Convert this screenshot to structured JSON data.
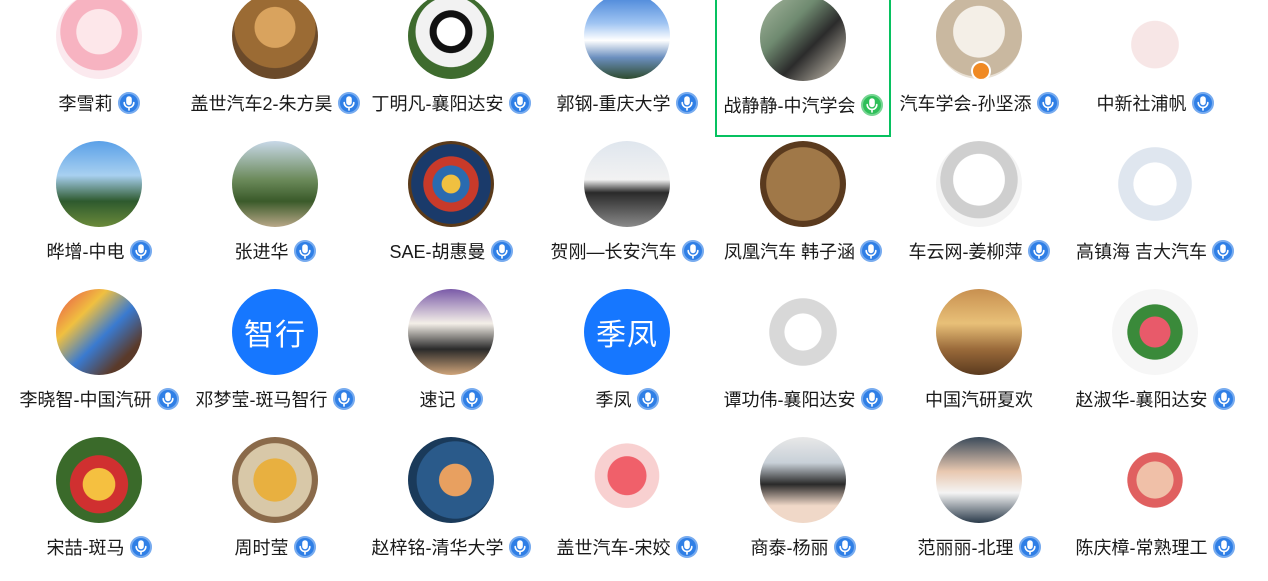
{
  "members": [
    {
      "name": "李雪莉",
      "mic": "blue",
      "avatar": {
        "kind": "image",
        "bg": "radial-gradient(circle at 50% 45%, #fde7ea 0 35%, #f7b3c1 36% 60%, #fbe9ee 61%)"
      }
    },
    {
      "name": "盖世汽车2-朱方昊",
      "mic": "blue",
      "avatar": {
        "kind": "image",
        "bg": "radial-gradient(circle at 50% 40%, #d9a35e 0 30%, #9b6b34 31% 60%, #6b4a2a 61%)"
      }
    },
    {
      "name": "丁明凡-襄阳达安",
      "mic": "blue",
      "avatar": {
        "kind": "image",
        "bg": "radial-gradient(circle at 50% 45%, #ffffff 0 22%, #111111 23% 33%, #f2f2f2 34% 55%, #3e6b2e 56%)"
      }
    },
    {
      "name": "郭钢-重庆大学",
      "mic": "blue",
      "avatar": {
        "kind": "image",
        "bg": "linear-gradient(180deg, #3f7fd6 0%, #9fc4f2 35%, #ffffff 55%, #6b8fbf 75%, #2e4b2e 100%)"
      }
    },
    {
      "name": "战静静-中汽学会",
      "mic": "green",
      "active": true,
      "avatar": {
        "kind": "image",
        "bg": "linear-gradient(135deg, #a8b8a0 0%, #6f8a70 35%, #2b2b2b 60%, #d8d0c0 100%)"
      }
    },
    {
      "name": "汽车学会-孙坚添",
      "mic": "blue",
      "badge": true,
      "avatar": {
        "kind": "image",
        "bg": "radial-gradient(circle at 50% 45%, #f4efe7 0 40%, #c9b8a0 41% 70%, #e8e0d4 71%)"
      }
    },
    {
      "name": "中新社浦帆",
      "mic": "blue",
      "avatar": {
        "kind": "image",
        "bg": "radial-gradient(circle at 50% 60%, #f7e6e6 0 35%, #ffffff 36%)"
      }
    },
    {
      "name": "晔增-中电",
      "mic": "blue",
      "avatar": {
        "kind": "image",
        "bg": "linear-gradient(180deg, #5aa0e8 0%, #a8d0f0 40%, #2e5a2e 70%, #6b8a3a 100%)"
      }
    },
    {
      "name": "张进华",
      "mic": "blue",
      "avatar": {
        "kind": "image",
        "bg": "linear-gradient(180deg, #c8d8e8 0%, #6b8a5a 45%, #3a5a2a 70%, #b8a888 100%)"
      }
    },
    {
      "name": "SAE-胡惠曼",
      "mic": "blue",
      "avatar": {
        "kind": "image",
        "bg": "radial-gradient(circle, #f0c040 0 15%, #2a6bb0 16% 30%, #c83a2a 31% 45%, #1a3a6a 46% 65%, #5a3a1a 66%)"
      }
    },
    {
      "name": "贺刚—长安汽车",
      "mic": "blue",
      "avatar": {
        "kind": "image",
        "bg": "linear-gradient(180deg, #dfe6ee 0%, #f2f2f2 45%, #2a2a2a 60%, #8a8a8a 100%)"
      }
    },
    {
      "name": "凤凰汽车 韩子涵",
      "mic": "blue",
      "avatar": {
        "kind": "image",
        "bg": "radial-gradient(circle, #a07848 0 60%, #5a3a1e 61%)"
      }
    },
    {
      "name": "车云网-姜柳萍",
      "mic": "blue",
      "avatar": {
        "kind": "image",
        "bg": "radial-gradient(circle at 50% 45%, #ffffff 0 40%, #cfcfcf 41% 60%, #f4f4f4 61%)"
      }
    },
    {
      "name": "高镇海 吉大汽车",
      "mic": "blue",
      "avatar": {
        "kind": "image",
        "bg": "radial-gradient(circle at 50% 50%, #ffffff 0 35%, #dfe6ef 36% 60%, #ffffff 61%)"
      }
    },
    {
      "name": "李晓智-中国汽研",
      "mic": "blue",
      "avatar": {
        "kind": "image",
        "bg": "linear-gradient(135deg, #e84a4a 0%, #f0c040 30%, #3a7ad0 55%, #5a3a2a 80%)"
      }
    },
    {
      "name": "邓梦莹-斑马智行",
      "mic": "blue",
      "avatar": {
        "kind": "text",
        "text": "智行",
        "bg": "#1677ff"
      }
    },
    {
      "name": "速记",
      "mic": "blue",
      "avatar": {
        "kind": "image",
        "bg": "linear-gradient(180deg, #7a5aa8 0%, #f4efe8 40%, #2a2a2a 70%, #cfa47a 100%)"
      }
    },
    {
      "name": "季凤",
      "mic": "blue",
      "avatar": {
        "kind": "text",
        "text": "季凤",
        "bg": "#1677ff"
      }
    },
    {
      "name": "谭功伟-襄阳达安",
      "mic": "blue",
      "avatar": {
        "kind": "image",
        "bg": "radial-gradient(circle at 50% 50%, #ffffff 0 30%, #d8d8d8 31% 55%, #ffffff 56%)"
      }
    },
    {
      "name": "中国汽研夏欢",
      "mic": "none",
      "avatar": {
        "kind": "image",
        "bg": "linear-gradient(180deg, #c89050 0%, #e8c078 40%, #9a6a3a 70%, #5a3a1e 100%)"
      }
    },
    {
      "name": "赵淑华-襄阳达安",
      "mic": "blue",
      "avatar": {
        "kind": "image",
        "bg": "radial-gradient(circle, #e85a6a 0 25%, #3a8a3a 26% 45%, #f6f6f6 46%)"
      }
    },
    {
      "name": "宋喆-斑马",
      "mic": "blue",
      "avatar": {
        "kind": "image",
        "bg": "radial-gradient(circle at 50% 55%, #f5c040 0 25%, #d03030 26% 45%, #3a6a2a 46%)"
      }
    },
    {
      "name": "周时莹",
      "mic": "blue",
      "avatar": {
        "kind": "image",
        "bg": "radial-gradient(circle, #e8b040 0 35%, #d8c8a8 36% 60%, #8a6a4a 61%)"
      }
    },
    {
      "name": "赵梓铭-清华大学",
      "mic": "blue",
      "avatar": {
        "kind": "image",
        "bg": "radial-gradient(circle at 55% 50%, #e8a060 0 25%, #2a5a8a 26% 60%, #1a3a5a 61%)"
      }
    },
    {
      "name": "盖世汽车-宋姣",
      "mic": "blue",
      "avatar": {
        "kind": "image",
        "bg": "radial-gradient(circle at 50% 45%, #f0606a 0 30%, #f8d0d0 31% 50%, #ffffff 51%)"
      }
    },
    {
      "name": "商泰-杨丽",
      "mic": "blue",
      "avatar": {
        "kind": "image",
        "bg": "linear-gradient(180deg, #e8e8e8 0%, #c8d0d8 30%, #2a2a2a 55%, #f0d8c8 80%)"
      }
    },
    {
      "name": "范丽丽-北理",
      "mic": "blue",
      "avatar": {
        "kind": "image",
        "bg": "linear-gradient(180deg, #3a4a5a 0%, #e8c8b0 40%, #f4f4f4 65%, #2a3a4a 100%)"
      }
    },
    {
      "name": "陈庆樟-常熟理工",
      "mic": "blue",
      "avatar": {
        "kind": "image",
        "bg": "radial-gradient(circle at 50% 50%, #f0c0a8 0 30%, #e06060 31% 45%, #ffffff 46%)"
      }
    }
  ]
}
